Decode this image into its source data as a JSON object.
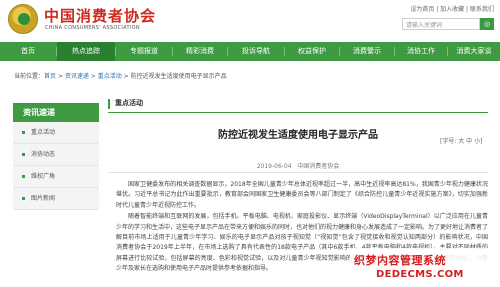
{
  "header": {
    "logo_cn": "中国消费者协会",
    "logo_en": "CHINA CONSUMERS' ASSOCIATION",
    "top_links": "设为首页 | 加入收藏 | 联系我们",
    "search_placeholder": "请输入关键词",
    "search_button": "◎"
  },
  "nav": {
    "items": [
      "首页",
      "热点追踪",
      "专题报道",
      "精彩消费",
      "投诉导航",
      "权益保护",
      "消费警示",
      "消协工作",
      "消费大家谈"
    ],
    "active_index": 1
  },
  "breadcrumb": {
    "prefix": "当前位置：",
    "home": "首页",
    "section": "资讯速递",
    "sub": "重点活动",
    "current": "防控近视发生适度使用电子显示产品"
  },
  "sidebar": {
    "title": "资讯速递",
    "items": [
      "重点活动",
      "消协动态",
      "维权广角",
      "图片新闻"
    ]
  },
  "main": {
    "section_label": "重点活动",
    "title": "防控近视发生适度使用电子显示产品",
    "font_size_control": "[字号: 大 中 小]",
    "date": "2019-06-04",
    "source": "中国消费者协会",
    "paragraphs": [
      "国家卫健委发布的相关调查数据显示，2018年全国儿童青少年总体近视率超过一半，高中生近视率高达81%，我国青少年视力健康状况堪忧。习近平总书记为此作出重要批示，教育部会同国家卫生健康委员会等八部门制定了《综合防控儿童青少年近视实施方案》，切实加强新时代儿童青少年近视防控工作。",
      "随着智能终端和互联网的发展，包括手机、平板电脑、电视机、家庭投影仪、显示终端（VideoDisplayTerminal）以广泛应用在儿童青少年的学习和生活中，这些电子显示产品在带来方便和娱乐的同时，也对他们的视力健康和身心发展造成了一定影响。为了更好地让消费者了解目前市场上适用于儿童青少年学习、娱乐的电子显示产品对孩子视知觉（“视知觉”包含了视觉接收和视觉认知两部分）的影响状况，中国消费者协会于2019年上半年，在市场上选购了具有代表性的18款电子产品（其中6款手机、4款平板电脑和4款电视机），主要对不同材质的屏幕进行比较试验，包括屏幕的亮度、色彩和视觉试验，以及对儿童青少年视知觉影响的测评（本次比较试验不突出具体品牌的对比），为青少年及家长在选购和使用电子产品时提供参考依据和指导。"
    ]
  },
  "watermark": {
    "text": "织梦内容管理系统",
    "url": "DEDECMS.COM"
  },
  "colors": {
    "brand_green": "#3e9b42",
    "brand_red": "#d02a1e"
  }
}
